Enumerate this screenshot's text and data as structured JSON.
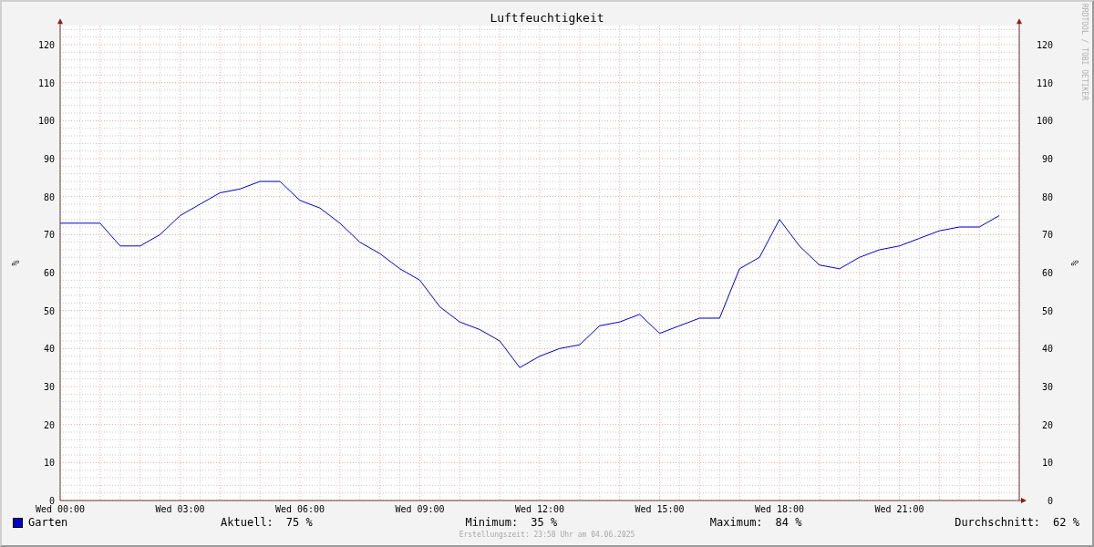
{
  "chart": {
    "chart_data": {
      "type": "line",
      "title": "Luftfeuchtigkeit",
      "ylabel": "%",
      "ylim": [
        0,
        125
      ],
      "grid": true,
      "categories": [
        "Wed 00:00",
        null,
        null,
        null,
        null,
        null,
        "Wed 03:00",
        null,
        null,
        null,
        null,
        null,
        "Wed 06:00",
        null,
        null,
        null,
        null,
        null,
        "Wed 09:00",
        null,
        null,
        null,
        null,
        null,
        "Wed 12:00",
        null,
        null,
        null,
        null,
        null,
        "Wed 15:00",
        null,
        null,
        null,
        null,
        null,
        "Wed 18:00",
        null,
        null,
        null,
        null,
        null,
        "Wed 21:00",
        null,
        null,
        null,
        null,
        null
      ],
      "yticks": [
        0,
        10,
        20,
        30,
        40,
        50,
        60,
        70,
        80,
        90,
        100,
        110,
        120
      ],
      "series": [
        {
          "name": "Garten",
          "color": "#0000cc",
          "values": [
            73,
            73,
            73,
            67,
            67,
            70,
            75,
            78,
            81,
            82,
            84,
            84,
            79,
            77,
            73,
            68,
            65,
            61,
            58,
            51,
            47,
            45,
            42,
            35,
            38,
            40,
            41,
            46,
            47,
            49,
            44,
            46,
            48,
            48,
            61,
            64,
            74,
            67,
            62,
            61,
            64,
            66,
            67,
            69,
            71,
            72,
            72,
            75
          ]
        }
      ]
    },
    "right_axis": {
      "ylabel": "%",
      "yticks": [
        "120",
        "110",
        "100",
        "90",
        "80",
        "70",
        "60",
        "50",
        "40",
        "30",
        "20",
        "10",
        "0"
      ]
    },
    "credit": "RRDTOOL / TOBI OETIKER"
  },
  "legend": {
    "stats": [
      {
        "label": "Aktuell:",
        "value": "75 %"
      },
      {
        "label": "Minimum:",
        "value": "35 %"
      },
      {
        "label": "Maximum:",
        "value": "84 %"
      },
      {
        "label": "Durchschnitt:",
        "value": "62 %"
      }
    ]
  },
  "footer": "Erstellungszeit: 23:58 Uhr am 04.06.2025"
}
